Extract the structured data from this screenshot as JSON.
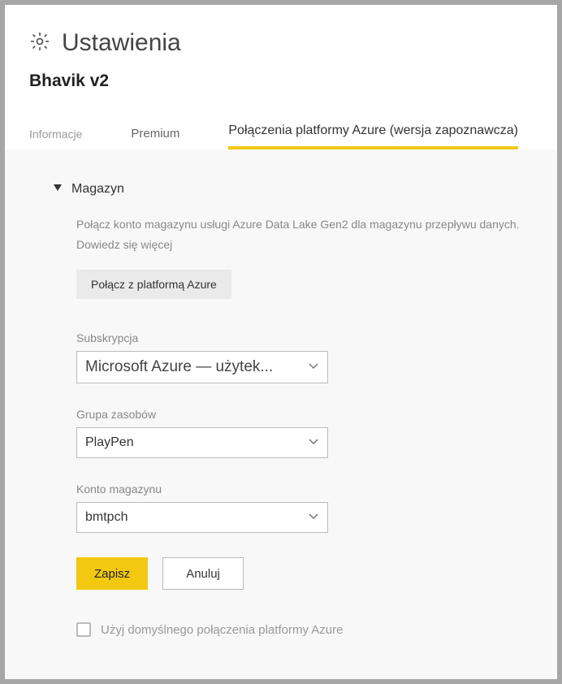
{
  "header": {
    "title": "Ustawienia",
    "subtitle": "Bhavik v2"
  },
  "tabs": {
    "info": "Informacje",
    "premium": "Premium",
    "azure": "Połączenia platformy Azure (wersja zapoznawcza)"
  },
  "section": {
    "title": "Magazyn",
    "description": "Połącz konto magazynu usługi Azure Data Lake Gen2 dla magazynu przepływu danych.",
    "learn_more": "Dowiedz się więcej",
    "connect_btn": "Połącz z platformą Azure"
  },
  "fields": {
    "subscription": {
      "label": "Subskrypcja",
      "value": "Microsoft Azure — użytek..."
    },
    "resource_group": {
      "label": "Grupa zasobów",
      "value": "PlayPen"
    },
    "storage_account": {
      "label": "Konto magazynu",
      "value": "bmtpch"
    }
  },
  "actions": {
    "save": "Zapisz",
    "cancel": "Anuluj"
  },
  "checkbox": {
    "label": "Użyj domyślnego połączenia platformy Azure"
  }
}
